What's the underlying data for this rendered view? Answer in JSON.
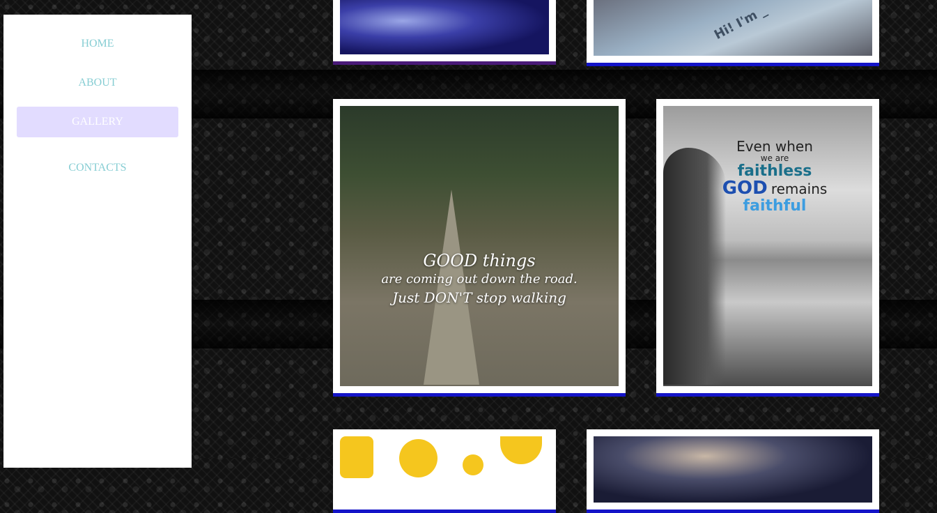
{
  "nav": {
    "items": [
      {
        "label": "HOME"
      },
      {
        "label": "ABOUT"
      },
      {
        "label": "GALLERY",
        "active": true
      },
      {
        "label": "CONTACTS"
      }
    ]
  },
  "gallery": {
    "quote_road": {
      "line1": "GOOD things",
      "line2": "are coming out down the road.",
      "line3": "Just DON'T stop walking"
    },
    "quote_faith": {
      "a": "Even when",
      "b": "we are",
      "c": "faithless",
      "d": "GOD",
      "e": "remains",
      "f": "faithful"
    },
    "note_text": "Hi! I'm _"
  },
  "colors": {
    "frame_border": "#1414c8",
    "nav_text": "#86cdd3",
    "nav_active_bg": "#e2dcff"
  }
}
